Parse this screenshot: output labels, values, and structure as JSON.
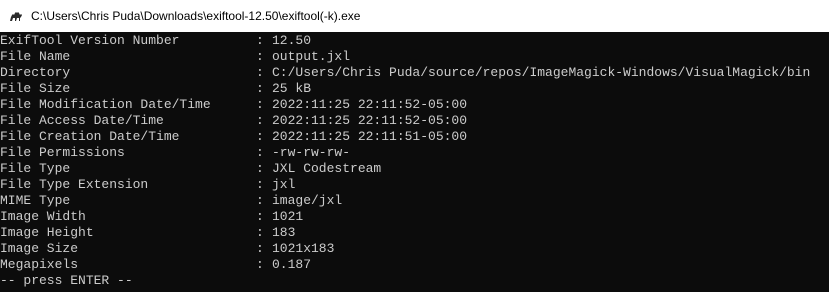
{
  "window": {
    "title": "C:\\Users\\Chris Puda\\Downloads\\exiftool-12.50\\exiftool(-k).exe",
    "icon": "camel-icon"
  },
  "console": {
    "separator": ":",
    "rows": [
      {
        "tag": "ExifTool Version Number",
        "value": "12.50"
      },
      {
        "tag": "File Name",
        "value": "output.jxl"
      },
      {
        "tag": "Directory",
        "value": "C:/Users/Chris Puda/source/repos/ImageMagick-Windows/VisualMagick/bin"
      },
      {
        "tag": "File Size",
        "value": "25 kB"
      },
      {
        "tag": "File Modification Date/Time",
        "value": "2022:11:25 22:11:52-05:00"
      },
      {
        "tag": "File Access Date/Time",
        "value": "2022:11:25 22:11:52-05:00"
      },
      {
        "tag": "File Creation Date/Time",
        "value": "2022:11:25 22:11:51-05:00"
      },
      {
        "tag": "File Permissions",
        "value": "-rw-rw-rw-"
      },
      {
        "tag": "File Type",
        "value": "JXL Codestream"
      },
      {
        "tag": "File Type Extension",
        "value": "jxl"
      },
      {
        "tag": "MIME Type",
        "value": "image/jxl"
      },
      {
        "tag": "Image Width",
        "value": "1021"
      },
      {
        "tag": "Image Height",
        "value": "183"
      },
      {
        "tag": "Image Size",
        "value": "1021x183"
      },
      {
        "tag": "Megapixels",
        "value": "0.187"
      }
    ],
    "prompt": "-- press ENTER --"
  },
  "colors": {
    "console_background": "#0c0c0c",
    "console_text": "#cccccc",
    "titlebar_background": "#ffffff",
    "titlebar_text": "#000000"
  }
}
